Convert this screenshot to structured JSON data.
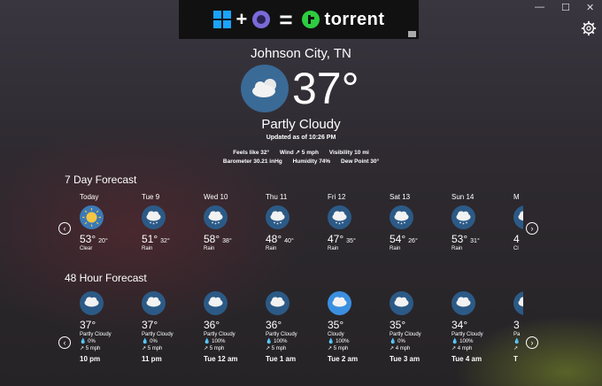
{
  "window": {
    "minimize": "—",
    "maximize": "☐",
    "close": "✕"
  },
  "ad": {
    "plus": "+",
    "equals": "=",
    "brand": "torrent"
  },
  "current": {
    "city": "Johnson City, TN",
    "temp": "37°",
    "condition": "Partly Cloudy",
    "updated": "Updated as of 10:26 PM",
    "feels_like": "Feels like  32°",
    "wind": "Wind  ↗  5 mph",
    "visibility": "Visibility  10 mi",
    "barometer": "Barometer  30.21 inHg",
    "humidity": "Humidity  74%",
    "dew_point": "Dew Point  30°"
  },
  "daily": {
    "title": "7 Day Forecast",
    "days": [
      {
        "name": "Today",
        "hi": "53°",
        "lo": "20°",
        "cond": "Clear",
        "icon": "sun-icon"
      },
      {
        "name": "Tue 9",
        "hi": "51°",
        "lo": "32°",
        "cond": "Rain",
        "icon": "rain-cloud-icon"
      },
      {
        "name": "Wed 10",
        "hi": "58°",
        "lo": "38°",
        "cond": "Rain",
        "icon": "rain-cloud-icon"
      },
      {
        "name": "Thu 11",
        "hi": "48°",
        "lo": "40°",
        "cond": "Rain",
        "icon": "rain-cloud-icon"
      },
      {
        "name": "Fri 12",
        "hi": "47°",
        "lo": "35°",
        "cond": "Rain",
        "icon": "rain-cloud-icon"
      },
      {
        "name": "Sat 13",
        "hi": "54°",
        "lo": "26°",
        "cond": "Rain",
        "icon": "rain-cloud-icon"
      },
      {
        "name": "Sun 14",
        "hi": "53°",
        "lo": "31°",
        "cond": "Rain",
        "icon": "rain-cloud-icon"
      },
      {
        "name": "M",
        "hi": "4",
        "lo": "",
        "cond": "Cl",
        "icon": "cloud-icon"
      }
    ]
  },
  "hourly": {
    "title": "48 Hour Forecast",
    "hours": [
      {
        "temp": "37°",
        "cond": "Partly Cloudy",
        "precip": "0%",
        "wind": "5 mph",
        "time": "10 pm"
      },
      {
        "temp": "37°",
        "cond": "Partly Cloudy",
        "precip": "0%",
        "wind": "5 mph",
        "time": "11 pm"
      },
      {
        "temp": "36°",
        "cond": "Partly Cloudy",
        "precip": "100%",
        "wind": "5 mph",
        "time": "Tue 12 am"
      },
      {
        "temp": "36°",
        "cond": "Partly Cloudy",
        "precip": "100%",
        "wind": "5 mph",
        "time": "Tue 1 am"
      },
      {
        "temp": "35°",
        "cond": "Cloudy",
        "precip": "100%",
        "wind": "5 mph",
        "time": "Tue 2 am"
      },
      {
        "temp": "35°",
        "cond": "Partly Cloudy",
        "precip": "0%",
        "wind": "4 mph",
        "time": "Tue 3 am"
      },
      {
        "temp": "34°",
        "cond": "Partly Cloudy",
        "precip": "100%",
        "wind": "4 mph",
        "time": "Tue 4 am"
      },
      {
        "temp": "3",
        "cond": "Pa",
        "precip": "",
        "wind": "",
        "time": "T"
      }
    ]
  },
  "colors": {
    "icon_bg": "#2c5a86",
    "sun": "#f5c542",
    "bright_icon_bg": "#3b8fe0"
  }
}
